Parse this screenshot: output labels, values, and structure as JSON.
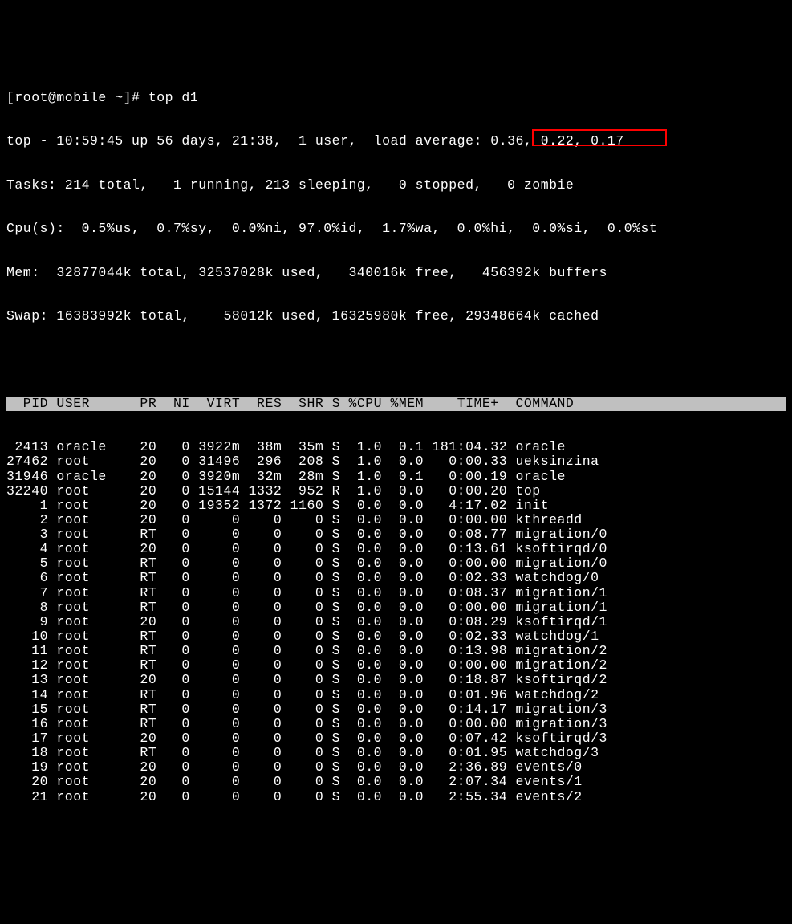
{
  "prompt": "[root@mobile ~]# top d1",
  "summary": {
    "line1": "top - 10:59:45 up 56 days, 21:38,  1 user,  load average: 0.36, 0.22, 0.17",
    "line2": "Tasks: 214 total,   1 running, 213 sleeping,   0 stopped,   0 zombie",
    "line3": "Cpu(s):  0.5%us,  0.7%sy,  0.0%ni, 97.0%id,  1.7%wa,  0.0%hi,  0.0%si,  0.0%st",
    "line4": "Mem:  32877044k total, 32537028k used,   340016k free,   456392k buffers",
    "line5": "Swap: 16383992k total,    58012k used, 16325980k free, 29348664k cached"
  },
  "header": "  PID USER      PR  NI  VIRT  RES  SHR S %CPU %MEM    TIME+  COMMAND           ",
  "rows": [
    " 2413 oracle    20   0 3922m  38m  35m S  1.0  0.1 181:04.32 oracle",
    "27462 root      20   0 31496  296  208 S  1.0  0.0   0:00.33 ueksinzina",
    "31946 oracle    20   0 3920m  32m  28m S  1.0  0.1   0:00.19 oracle",
    "32240 root      20   0 15144 1332  952 R  1.0  0.0   0:00.20 top",
    "    1 root      20   0 19352 1372 1160 S  0.0  0.0   4:17.02 init",
    "    2 root      20   0     0    0    0 S  0.0  0.0   0:00.00 kthreadd",
    "    3 root      RT   0     0    0    0 S  0.0  0.0   0:08.77 migration/0",
    "    4 root      20   0     0    0    0 S  0.0  0.0   0:13.61 ksoftirqd/0",
    "    5 root      RT   0     0    0    0 S  0.0  0.0   0:00.00 migration/0",
    "    6 root      RT   0     0    0    0 S  0.0  0.0   0:02.33 watchdog/0",
    "    7 root      RT   0     0    0    0 S  0.0  0.0   0:08.37 migration/1",
    "    8 root      RT   0     0    0    0 S  0.0  0.0   0:00.00 migration/1",
    "    9 root      20   0     0    0    0 S  0.0  0.0   0:08.29 ksoftirqd/1",
    "   10 root      RT   0     0    0    0 S  0.0  0.0   0:02.33 watchdog/1",
    "   11 root      RT   0     0    0    0 S  0.0  0.0   0:13.98 migration/2",
    "   12 root      RT   0     0    0    0 S  0.0  0.0   0:00.00 migration/2",
    "   13 root      20   0     0    0    0 S  0.0  0.0   0:18.87 ksoftirqd/2",
    "   14 root      RT   0     0    0    0 S  0.0  0.0   0:01.96 watchdog/2",
    "   15 root      RT   0     0    0    0 S  0.0  0.0   0:14.17 migration/3",
    "   16 root      RT   0     0    0    0 S  0.0  0.0   0:00.00 migration/3",
    "   17 root      20   0     0    0    0 S  0.0  0.0   0:07.42 ksoftirqd/3",
    "   18 root      RT   0     0    0    0 S  0.0  0.0   0:01.95 watchdog/3",
    "   19 root      20   0     0    0    0 S  0.0  0.0   2:36.89 events/0",
    "   20 root      20   0     0    0    0 S  0.0  0.0   2:07.34 events/1",
    "   21 root      20   0     0    0    0 S  0.0  0.0   2:55.34 events/2"
  ]
}
